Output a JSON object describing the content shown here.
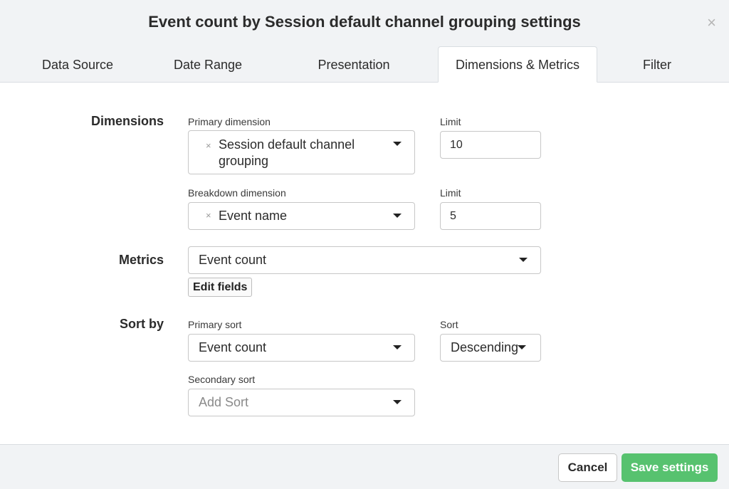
{
  "dialog": {
    "title": "Event count by Session default channel grouping settings",
    "close_glyph": "×"
  },
  "tabs": [
    {
      "label": "Data Source"
    },
    {
      "label": "Date Range"
    },
    {
      "label": "Presentation"
    },
    {
      "label": "Dimensions & Metrics",
      "active": true
    },
    {
      "label": "Filter"
    }
  ],
  "dimensions": {
    "section_label": "Dimensions",
    "primary": {
      "label": "Primary dimension",
      "value_line1": "Session default channel",
      "value_line2": "grouping",
      "clear_glyph": "×"
    },
    "primary_limit": {
      "label": "Limit",
      "value": "10"
    },
    "breakdown": {
      "label": "Breakdown dimension",
      "value": "Event name",
      "clear_glyph": "×"
    },
    "breakdown_limit": {
      "label": "Limit",
      "value": "5"
    }
  },
  "metrics": {
    "section_label": "Metrics",
    "value": "Event count",
    "edit_label": "Edit fields"
  },
  "sort": {
    "section_label": "Sort by",
    "primary": {
      "label": "Primary sort",
      "value": "Event count"
    },
    "order": {
      "label": "Sort",
      "value": "Descending"
    },
    "secondary": {
      "label": "Secondary sort",
      "placeholder": "Add Sort"
    }
  },
  "footer": {
    "cancel_label": "Cancel",
    "save_label": "Save settings"
  },
  "colors": {
    "save_button": "#57c26f",
    "header_bg": "#f1f3f5"
  }
}
